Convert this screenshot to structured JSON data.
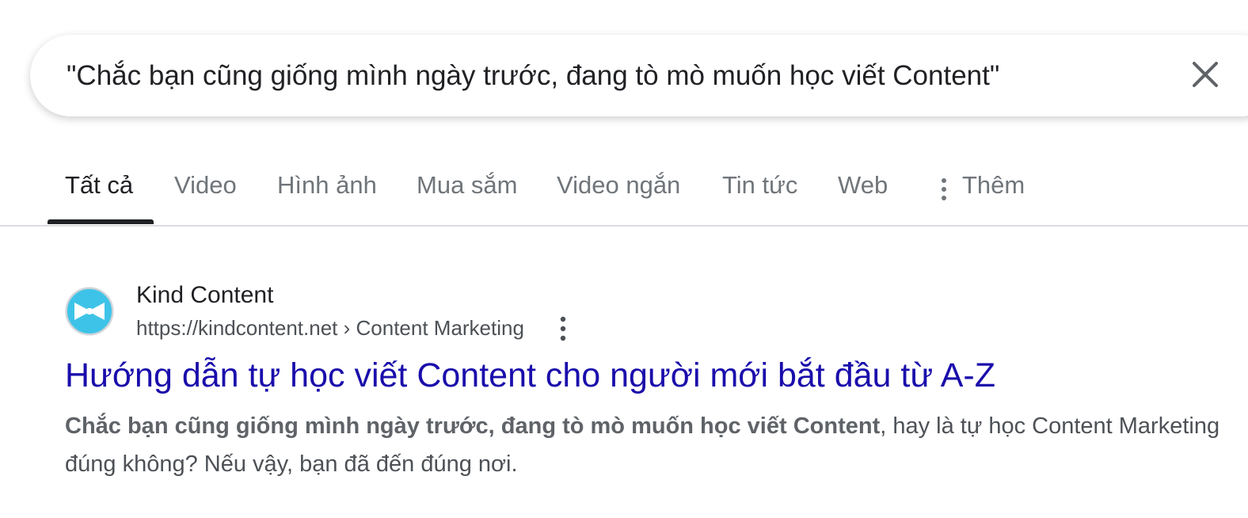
{
  "search": {
    "query": "\"Chắc bạn cũng giống mình ngày trước, đang tò mò muốn học viết Content\""
  },
  "tabs": [
    {
      "label": "Tất cả",
      "active": true
    },
    {
      "label": "Video",
      "active": false
    },
    {
      "label": "Hình ảnh",
      "active": false
    },
    {
      "label": "Mua sắm",
      "active": false
    },
    {
      "label": "Video ngắn",
      "active": false
    },
    {
      "label": "Tin tức",
      "active": false
    },
    {
      "label": "Web",
      "active": false
    },
    {
      "label": "Thêm",
      "active": false
    }
  ],
  "result": {
    "site_name": "Kind Content",
    "url": "https://kindcontent.net › Content Marketing",
    "title": "Hướng dẫn tự học viết Content cho người mới bắt đầu từ A-Z",
    "snippet_bold": "Chắc bạn cũng giống mình ngày trước, đang tò mò muốn học viết Content",
    "snippet_rest": ", hay là tự học Content Marketing đúng không? Nếu vậy, bạn đã đến đúng nơi."
  },
  "icons": {
    "clear": "close-icon",
    "more": "more-vert-icon",
    "favicon": "bow-tie-icon",
    "result_menu": "more-vert-icon"
  },
  "colors": {
    "title_link": "#1a0dab",
    "favicon_bg": "#3ec3e8",
    "active_tab": "#202124",
    "inactive_tab": "#70757a"
  }
}
